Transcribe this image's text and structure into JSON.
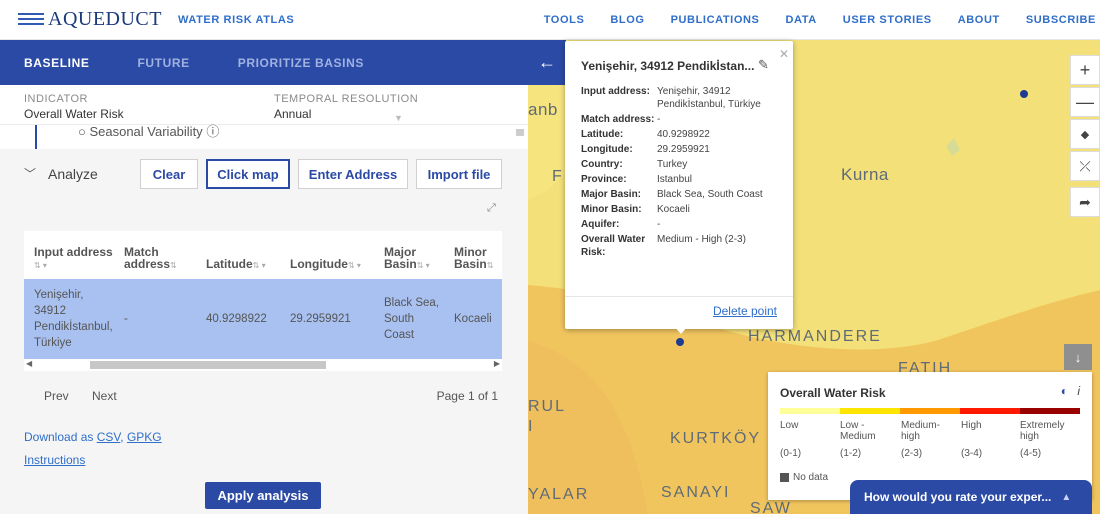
{
  "header": {
    "logo": "AQUEDUCT",
    "subtitle": "WATER RISK ATLAS",
    "nav": [
      "TOOLS",
      "BLOG",
      "PUBLICATIONS",
      "DATA",
      "USER STORIES",
      "ABOUT",
      "SUBSCRIBE"
    ]
  },
  "sidebar": {
    "tabs": [
      "BASELINE",
      "FUTURE",
      "PRIORITIZE BASINS"
    ],
    "indicator_label": "INDICATOR",
    "indicator_value": "Overall Water Risk",
    "temporal_label": "TEMPORAL RESOLUTION",
    "temporal_value": "Annual",
    "seasonal_text": "Seasonal Variability",
    "analyze_label": "Analyze",
    "buttons": {
      "clear": "Clear",
      "click_map": "Click map",
      "enter_address": "Enter Address",
      "import_file": "Import file"
    },
    "table": {
      "headers": [
        "Input address",
        "Match address",
        "Latitude",
        "Longitude",
        "Major Basin",
        "Minor Basin"
      ],
      "row": {
        "input_address": "Yenişehir, 34912 Pendikİstanbul, Türkiye",
        "match_address": "-",
        "latitude": "40.9298922",
        "longitude": "29.2959921",
        "major_basin": "Black Sea, South Coast",
        "minor_basin": "Kocaeli"
      }
    },
    "pager": {
      "prev": "Prev",
      "next": "Next",
      "page": "Page 1 of 1"
    },
    "download_label": "Download as",
    "download_csv": "CSV",
    "download_gpkg": "GPKG",
    "instructions": "Instructions",
    "apply": "Apply analysis"
  },
  "map": {
    "labels": {
      "kurna": "Kurna",
      "harmandere": "HARMANDERE",
      "kurtkoy": "KURTKÖY",
      "sanayi": "SANAYI",
      "fatih": "FATIH",
      "rul": "RUL",
      "yalar": "YALAR",
      "anb": "anb",
      "f": "F",
      "saw": "SAW",
      "i": "I"
    },
    "popup": {
      "title": "Yenişehir, 34912 Pendikİstan...",
      "rows": [
        {
          "k": "Input address:",
          "v": "Yenişehir, 34912 Pendikİstanbul, Türkiye"
        },
        {
          "k": "Match address:",
          "v": "-"
        },
        {
          "k": "Latitude:",
          "v": "40.9298922"
        },
        {
          "k": "Longitude:",
          "v": "29.2959921"
        },
        {
          "k": "Country:",
          "v": "Turkey"
        },
        {
          "k": "Province:",
          "v": "Istanbul"
        },
        {
          "k": "Major Basin:",
          "v": "Black Sea, South Coast"
        },
        {
          "k": "Minor Basin:",
          "v": "Kocaeli"
        },
        {
          "k": "Aquifer:",
          "v": "-"
        },
        {
          "k": "Overall Water Risk:",
          "v": "Medium - High (2-3)"
        }
      ],
      "delete": "Delete point"
    },
    "legend": {
      "title": "Overall Water Risk",
      "categories": [
        {
          "label": "Low",
          "range": "(0-1)",
          "color": "#ffff99"
        },
        {
          "label": "Low - Medium",
          "range": "(1-2)",
          "color": "#ffe600"
        },
        {
          "label": "Medium- high",
          "range": "(2-3)",
          "color": "#ff9900"
        },
        {
          "label": "High",
          "range": "(3-4)",
          "color": "#ff1900"
        },
        {
          "label": "Extremely high",
          "range": "(4-5)",
          "color": "#990000"
        }
      ],
      "nodata": "No data"
    },
    "feedback": "How would you rate your exper..."
  }
}
